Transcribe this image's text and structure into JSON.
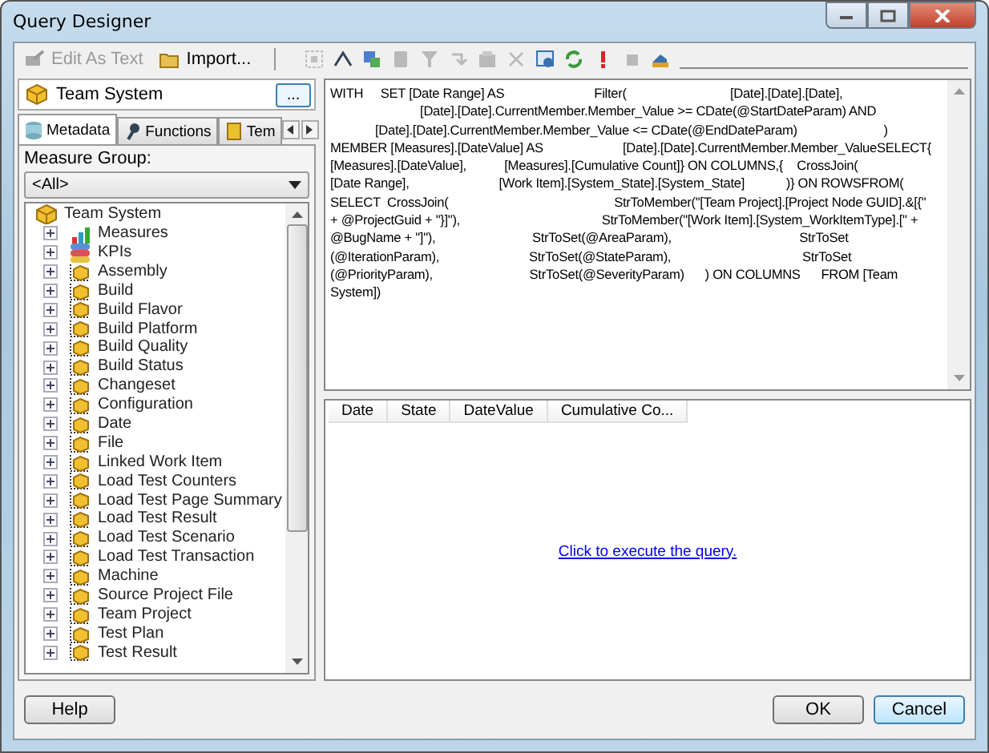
{
  "window": {
    "title": "Query Designer"
  },
  "toolbar": {
    "items": [
      {
        "kind": "text-button",
        "label": "Edit As Text",
        "disabled": true
      },
      {
        "kind": "text-button",
        "label": "Import...",
        "disabled": false
      },
      {
        "kind": "separator"
      },
      {
        "kind": "icon",
        "disabled": true
      },
      {
        "kind": "icon",
        "disabled": false
      },
      {
        "kind": "icon",
        "disabled": false
      },
      {
        "kind": "icon",
        "disabled": true
      },
      {
        "kind": "icon",
        "disabled": true
      },
      {
        "kind": "icon",
        "disabled": true
      },
      {
        "kind": "icon",
        "disabled": true
      },
      {
        "kind": "icon",
        "disabled": true
      },
      {
        "kind": "icon",
        "disabled": false
      },
      {
        "kind": "icon",
        "disabled": false
      },
      {
        "kind": "icon",
        "disabled": false
      },
      {
        "kind": "icon",
        "disabled": true
      },
      {
        "kind": "icon",
        "disabled": false
      }
    ]
  },
  "cube": {
    "name": "Team System",
    "browse_button": "..."
  },
  "tabs": [
    {
      "label": "Metadata",
      "selected": true
    },
    {
      "label": "Functions",
      "selected": false
    },
    {
      "label": "Tem",
      "selected": false
    }
  ],
  "measure_group": {
    "label": "Measure Group:",
    "value": "<All>"
  },
  "tree": {
    "root": "Team System",
    "children": [
      {
        "label": "Measures",
        "kind": "measures"
      },
      {
        "label": "KPIs",
        "kind": "kpis"
      },
      {
        "label": "Assembly",
        "kind": "dimension"
      },
      {
        "label": "Build",
        "kind": "dimension"
      },
      {
        "label": "Build Flavor",
        "kind": "dimension"
      },
      {
        "label": "Build Platform",
        "kind": "dimension"
      },
      {
        "label": "Build Quality",
        "kind": "dimension"
      },
      {
        "label": "Build Status",
        "kind": "dimension"
      },
      {
        "label": "Changeset",
        "kind": "dimension"
      },
      {
        "label": "Configuration",
        "kind": "dimension"
      },
      {
        "label": "Date",
        "kind": "dimension"
      },
      {
        "label": "File",
        "kind": "dimension"
      },
      {
        "label": "Linked Work Item",
        "kind": "dimension"
      },
      {
        "label": "Load Test Counters",
        "kind": "dimension"
      },
      {
        "label": "Load Test Page Summary",
        "kind": "dimension"
      },
      {
        "label": "Load Test Result",
        "kind": "dimension"
      },
      {
        "label": "Load Test Scenario",
        "kind": "dimension"
      },
      {
        "label": "Load Test Transaction",
        "kind": "dimension"
      },
      {
        "label": "Machine",
        "kind": "dimension"
      },
      {
        "label": "Source Project File",
        "kind": "dimension"
      },
      {
        "label": "Team Project",
        "kind": "dimension"
      },
      {
        "label": "Test Plan",
        "kind": "dimension"
      },
      {
        "label": "Test Result",
        "kind": "dimension"
      }
    ]
  },
  "query_lines": [
    "WITH     SET [Date Range] AS                          Filter(                              [Date].[Date].[Date],",
    "                          [Date].[Date].CurrentMember.Member_Value >= CDate(@StartDateParam) AND",
    "             [Date].[Date].CurrentMember.Member_Value <= CDate(@EndDateParam)                         )",
    "MEMBER [Measures].[DateValue] AS                       [Date].[Date].CurrentMember.Member_ValueSELECT{",
    "[Measures].[DateValue],           [Measures].[Cumulative Count]} ON COLUMNS,{    CrossJoin(",
    "[Date Range],                          [Work Item].[System_State].[System_State]            )} ON ROWSFROM(",
    "SELECT  CrossJoin(                                                StrToMember(\"[Team Project].[Project Node GUID].&[{\"",
    "+ @ProjectGuid + \"}]\"),                                         StrToMember(\"[Work Item].[System_WorkItemType].[\" +",
    "@BugName + \"]\"),                            StrToSet(@AreaParam),                                     StrToSet",
    "(@IterationParam),                          StrToSet(@StateParam),                                      StrToSet",
    "(@PriorityParam),                            StrToSet(@SeverityParam)      ) ON COLUMNS      FROM [Team",
    "System])"
  ],
  "results": {
    "columns": [
      "Date",
      "State",
      "DateValue",
      "Cumulative Co..."
    ],
    "execute_link": "Click to execute the query."
  },
  "buttons": {
    "help": "Help",
    "ok": "OK",
    "cancel": "Cancel"
  }
}
